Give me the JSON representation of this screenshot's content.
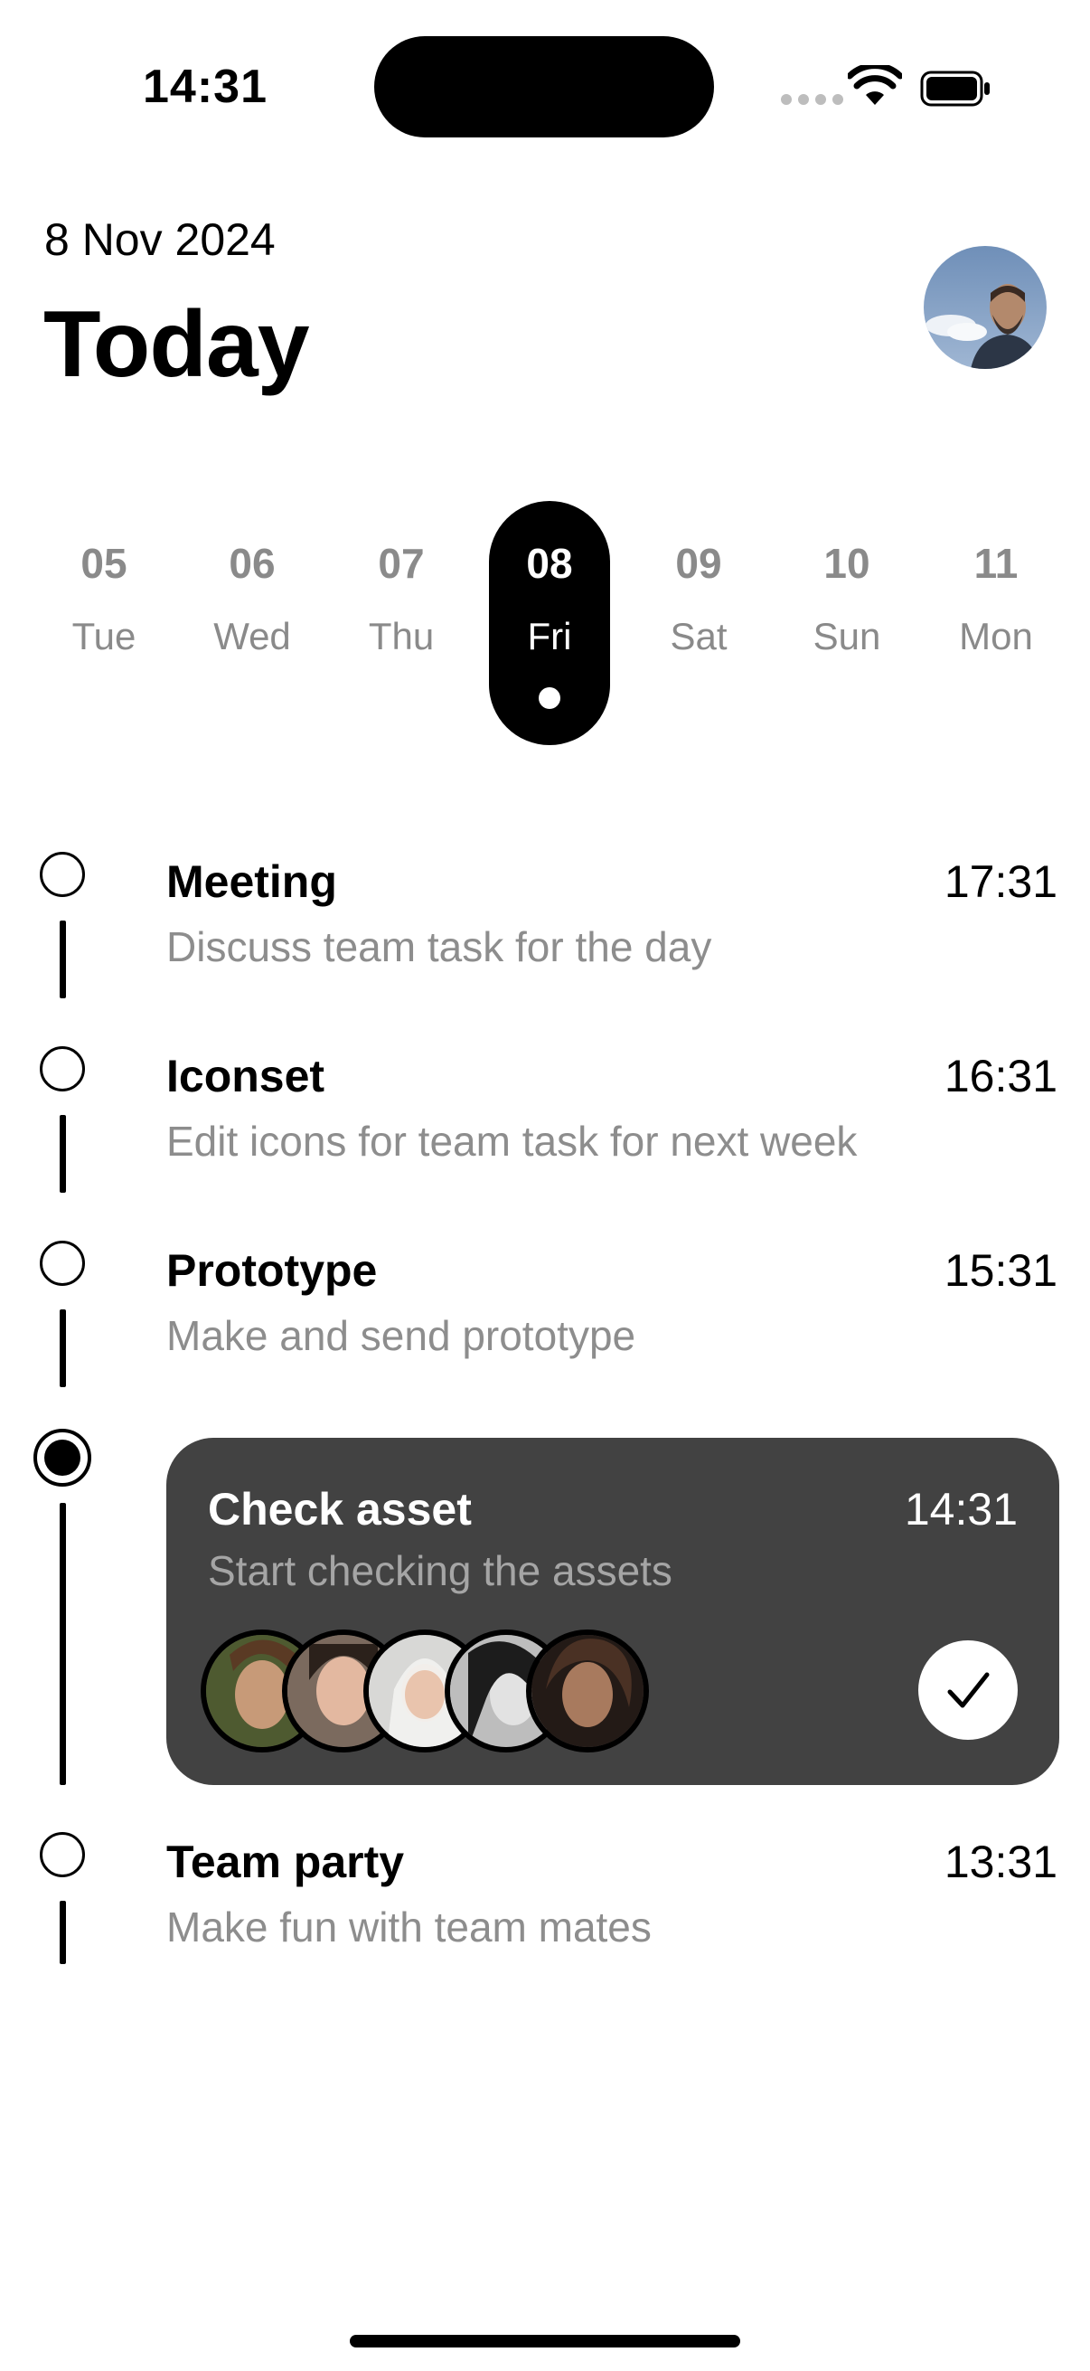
{
  "status_bar": {
    "time": "14:31"
  },
  "header": {
    "date": "8 Nov 2024",
    "title": "Today",
    "avatar_icon": "user-avatar"
  },
  "week": [
    {
      "num": "05",
      "name": "Tue",
      "selected": false
    },
    {
      "num": "06",
      "name": "Wed",
      "selected": false
    },
    {
      "num": "07",
      "name": "Thu",
      "selected": false
    },
    {
      "num": "08",
      "name": "Fri",
      "selected": true
    },
    {
      "num": "09",
      "name": "Sat",
      "selected": false
    },
    {
      "num": "10",
      "name": "Sun",
      "selected": false
    },
    {
      "num": "11",
      "name": "Mon",
      "selected": false
    }
  ],
  "tasks": [
    {
      "title": "Meeting",
      "time": "17:31",
      "desc": "Discuss team task for the day"
    },
    {
      "title": "Iconset",
      "time": "16:31",
      "desc": "Edit icons for team task for next week"
    },
    {
      "title": "Prototype",
      "time": "15:31",
      "desc": "Make and send prototype"
    },
    {
      "title": "Check asset",
      "time": "14:31",
      "desc": "Start checking the assets",
      "active": true,
      "participants": 5
    },
    {
      "title": "Team party",
      "time": "13:31",
      "desc": "Make fun with team mates"
    }
  ],
  "colors": {
    "card": "#424242",
    "muted": "#8d8d8d",
    "accent": "#000000"
  }
}
